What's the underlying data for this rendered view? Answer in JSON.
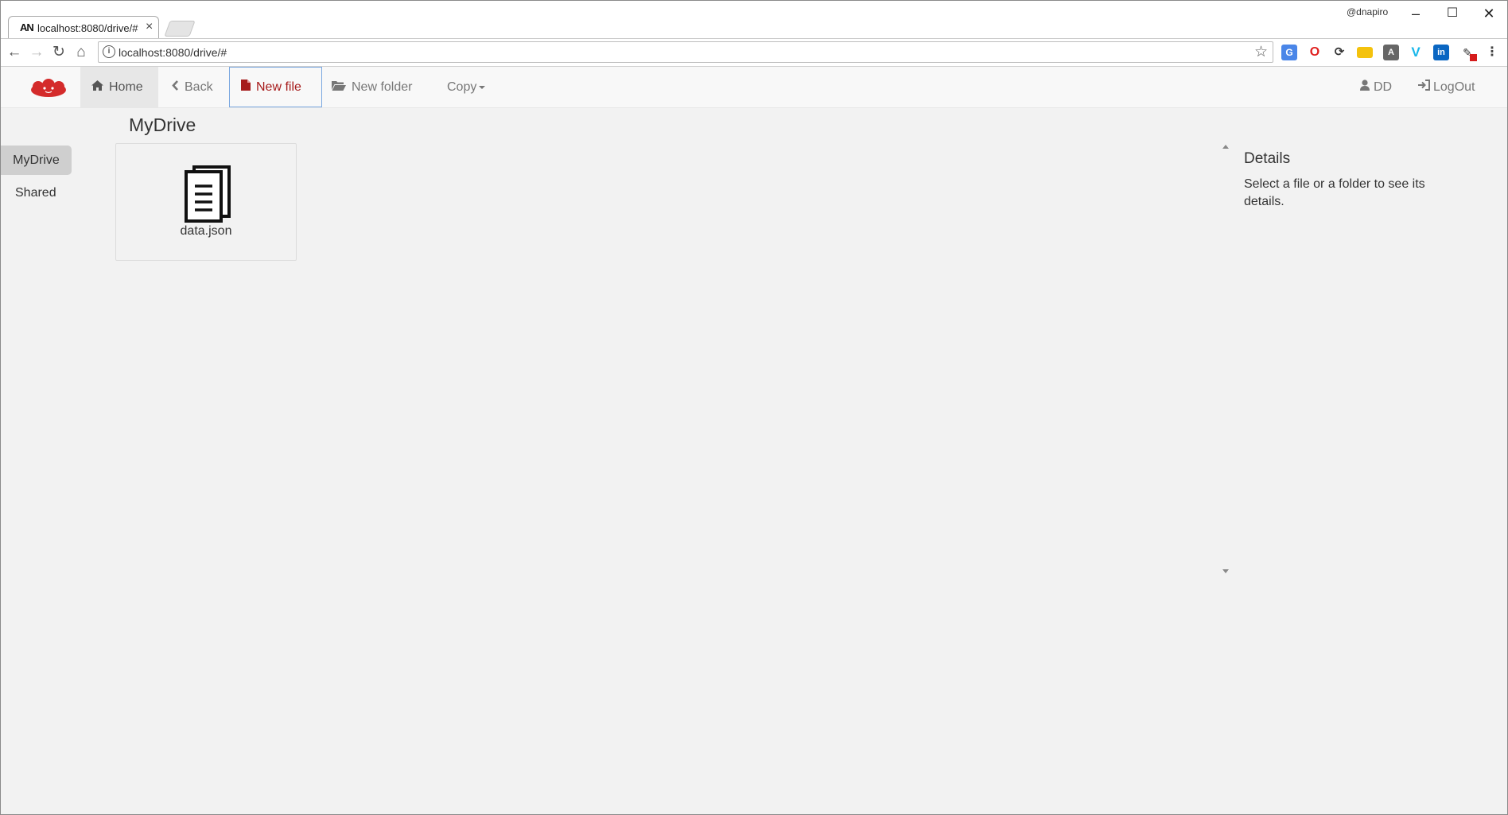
{
  "browser": {
    "tab_title": "localhost:8080/drive/#",
    "tab_favicon": "AN",
    "tab_close": "×",
    "profile_name": "@dnapiro",
    "url": "localhost:8080/drive/#",
    "window_controls": {
      "minimize": "–",
      "maximize": "☐",
      "close": "✕"
    },
    "nav_icons": {
      "back": "←",
      "forward": "→",
      "reload": "↻",
      "home": "⌂"
    },
    "star": "☆",
    "extensions": [
      "translate-icon",
      "opera-icon",
      "sync-icon",
      "notes-icon",
      "angular-icon",
      "vimeo-icon",
      "linkedin-icon",
      "edit-icon",
      "menu-icon"
    ]
  },
  "navbar": {
    "home_label": "Home",
    "back_label": "Back",
    "new_file_label": "New file",
    "new_folder_label": "New folder",
    "copy_label": "Copy",
    "user_label": "DD",
    "logout_label": "LogOut",
    "colors": {
      "brand": "#d42b2b",
      "active": "#a61b1b"
    }
  },
  "main": {
    "title": "MyDrive",
    "sidebar": [
      {
        "label": "MyDrive",
        "active": true
      },
      {
        "label": "Shared",
        "active": false
      }
    ],
    "files": [
      {
        "name": "data.json",
        "icon": "document-icon"
      }
    ]
  },
  "details": {
    "title": "Details",
    "text": "Select a file or a folder to see its details."
  }
}
